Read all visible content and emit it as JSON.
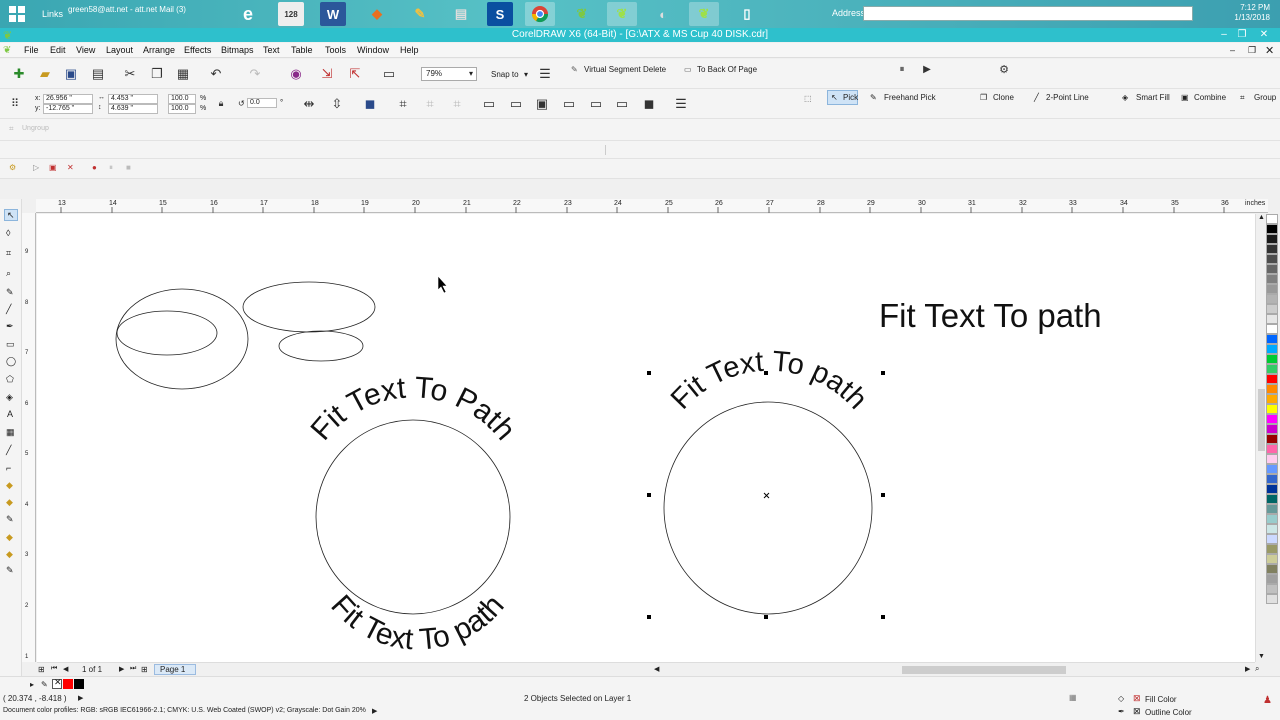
{
  "taskbar": {
    "links_label": "Links",
    "mail_label": "green58@att.net - att.net Mail (3)",
    "address_label": "Address",
    "clock_time": "7:12 PM",
    "clock_date": "1/13/2018",
    "apps": [
      "windows-logo",
      "ie",
      "calendar-128",
      "word",
      "app-orange",
      "app-pencil",
      "printer",
      "s-app",
      "chrome",
      "leaf-app-1",
      "leaf-app-2",
      "mouse-app",
      "leaf-app-3",
      "document"
    ]
  },
  "window": {
    "title": "CorelDRAW X6 (64-Bit) - [G:\\ATX & MS Cup 40 DISK.cdr]"
  },
  "menu": [
    "File",
    "Edit",
    "View",
    "Layout",
    "Arrange",
    "Effects",
    "Bitmaps",
    "Text",
    "Table",
    "Tools",
    "Window",
    "Help"
  ],
  "standard_toolbar": {
    "zoom": "79%",
    "snap_to": "Snap to",
    "virtual_segment_delete": "Virtual Segment Delete",
    "to_back_of_page": "To Back Of Page"
  },
  "property_bar": {
    "x": "26.956 \"",
    "y": "-12.765 \"",
    "x_label": "x:",
    "y_label": "y:",
    "width": "4.453 \"",
    "height": "4.639 \"",
    "scale_x": "100.0",
    "scale_y": "100.0",
    "percent": "%",
    "rotation": "0.0",
    "degree": "°",
    "pick": "Pick",
    "freehand_pick": "Freehand Pick",
    "clone": "Clone",
    "two_point_line": "2-Point Line",
    "smart_fill": "Smart Fill",
    "combine": "Combine",
    "group": "Group",
    "ungroup": "Ungroup"
  },
  "ruler": {
    "ticks": [
      "13",
      "14",
      "15",
      "16",
      "17",
      "18",
      "19",
      "20",
      "21",
      "22",
      "23",
      "24",
      "25",
      "26",
      "27",
      "28",
      "29",
      "30",
      "31",
      "32",
      "33",
      "34",
      "35",
      "36"
    ],
    "unit": "inches",
    "vticks": [
      "9",
      "8",
      "7",
      "6",
      "5",
      "4",
      "3",
      "2",
      "1"
    ]
  },
  "canvas": {
    "heading": "Fit Text To path",
    "left_circle_top_text": "Fit Text To Path",
    "left_circle_bottom_text": "Fit Text To path",
    "right_circle_text": "Fit Text To path"
  },
  "page_nav": {
    "page_count": "1 of 1",
    "page_tab": "Page 1"
  },
  "status": {
    "coords": "( 20.374 , -8.418 )",
    "selection": "2 Objects Selected on Layer 1",
    "color_profiles": "Document color profiles: RGB: sRGB IEC61966-2.1; CMYK: U.S. Web Coated (SWOP) v2; Grayscale: Dot Gain 20%",
    "fill_color": "Fill Color",
    "outline_color": "Outline Color"
  },
  "palette": [
    "#ffffff",
    "#000000",
    "#1a1a1a",
    "#333333",
    "#4d4d4d",
    "#666666",
    "#808080",
    "#999999",
    "#b3b3b3",
    "#cccccc",
    "#e6e6e6",
    "#ffffff",
    "#0066ff",
    "#00aaff",
    "#00cc33",
    "#33cc66",
    "#ff0000",
    "#ff8800",
    "#ffaa00",
    "#ffff00",
    "#ff00ff",
    "#cc00cc",
    "#990000",
    "#ff66aa",
    "#ffccee",
    "#6699ff",
    "#3366cc",
    "#003399",
    "#006666",
    "#669999",
    "#99cccc",
    "#cce6e6",
    "#ccd9ff",
    "#999966",
    "#cccc99",
    "#808060",
    "#a0a0a0",
    "#c0c0c0",
    "#e0e0e0"
  ],
  "colors": {
    "accent_title": "#2ec0cc",
    "taskbar": "#3aa6b2",
    "selection": "#cfe3f6"
  }
}
